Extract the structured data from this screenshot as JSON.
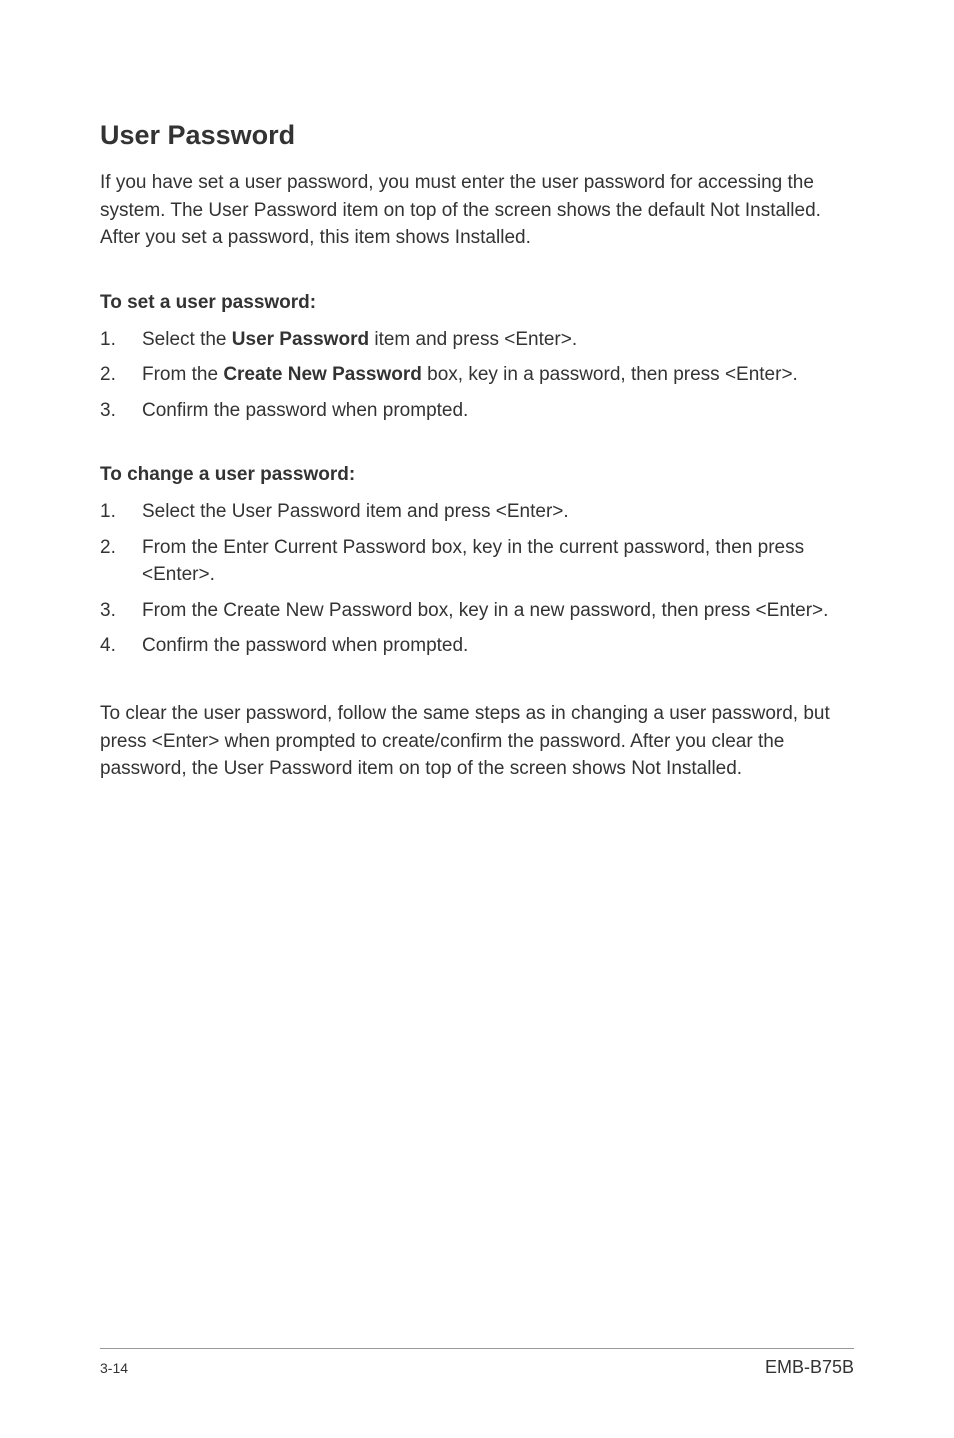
{
  "heading": "User Password",
  "intro": "If you have set a user password, you must enter the user password for accessing the system. The User Password item on top of the screen shows the default Not Installed. After you set a password, this item shows Installed.",
  "section1": {
    "title": "To set a user password:",
    "items": [
      {
        "num": "1.",
        "prefix": "Select the ",
        "bold": "User Password",
        "suffix": " item and press <Enter>."
      },
      {
        "num": "2.",
        "prefix": "From the ",
        "bold": "Create New Password",
        "suffix": " box, key in a password, then press <Enter>."
      },
      {
        "num": "3.",
        "text": "Confirm the password when prompted."
      }
    ]
  },
  "section2": {
    "title": "To change a user password:",
    "items": [
      {
        "num": "1.",
        "text": "Select the User Password item and press <Enter>."
      },
      {
        "num": "2.",
        "text": "From the Enter Current Password box, key in the current password, then press <Enter>."
      },
      {
        "num": "3.",
        "text": "From the Create New Password box, key in a new password, then press <Enter>."
      },
      {
        "num": "4.",
        "text": "Confirm the password when prompted."
      }
    ]
  },
  "closing": "To clear the user password, follow the same steps as in changing a user password, but press <Enter> when prompted to create/confirm the password. After you clear the password, the User Password item on top of the screen shows Not Installed.",
  "footer": {
    "page": "3-14",
    "product": "EMB-B75B"
  }
}
